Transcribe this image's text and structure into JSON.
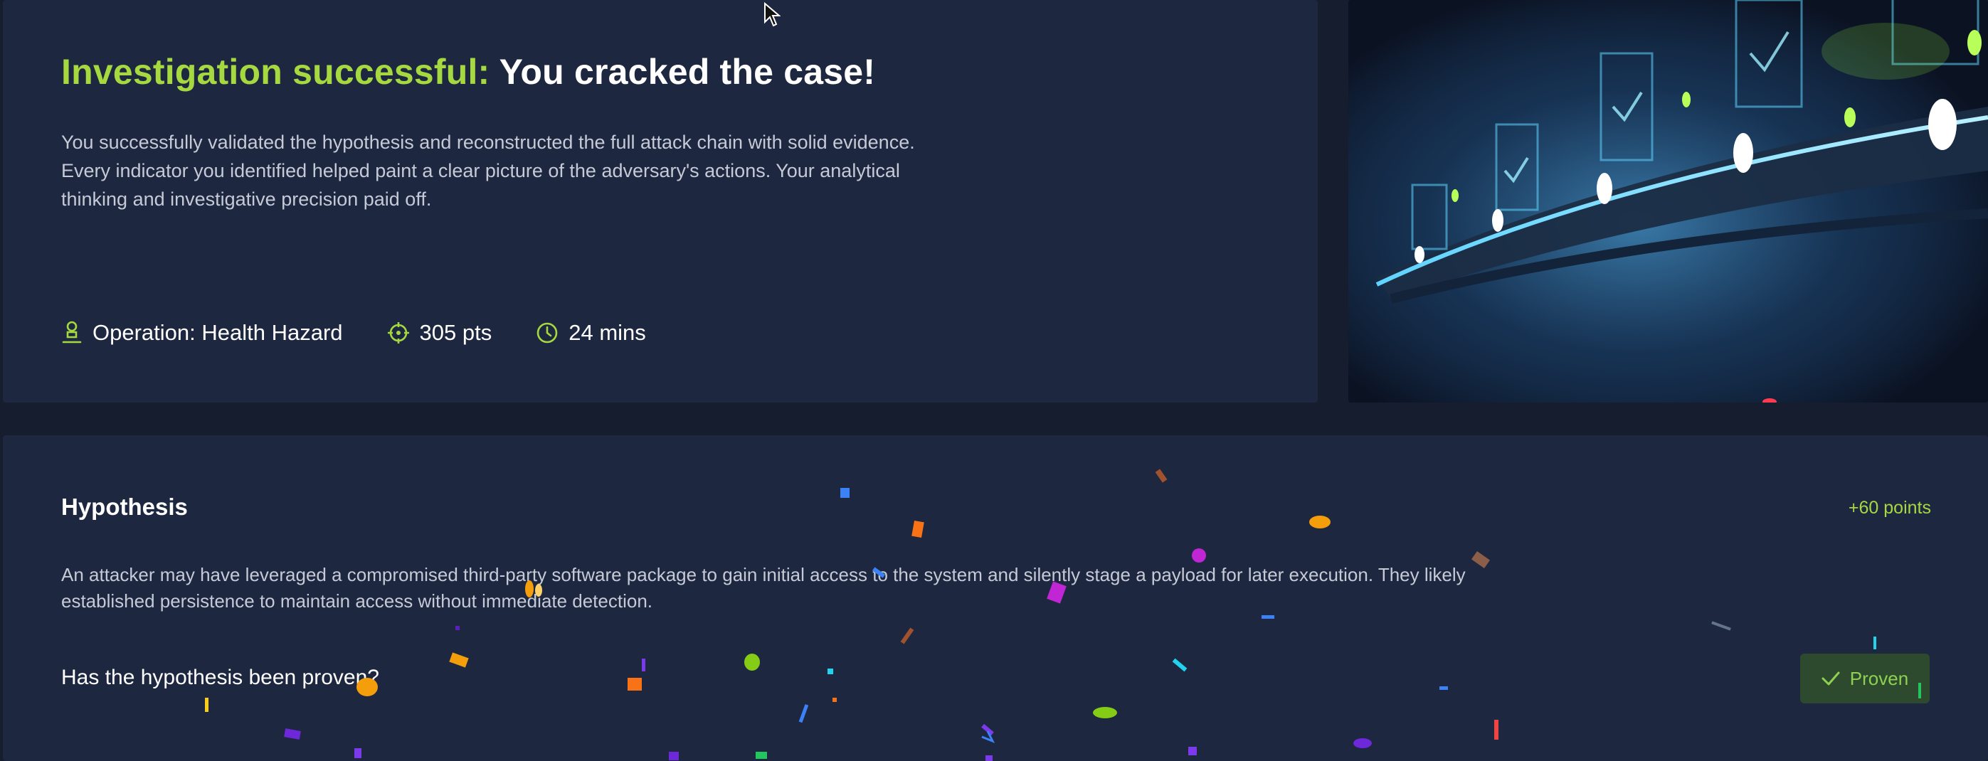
{
  "result": {
    "headline_accent": "Investigation successful:",
    "headline_rest": "You cracked the case!",
    "summary": "You successfully validated the hypothesis and reconstructed the full attack chain with solid evidence. Every indicator you identified helped paint a clear picture of the adversary's actions. Your analytical thinking and investigative precision paid off.",
    "operation": "Operation: Health Hazard",
    "points": "305 pts",
    "duration": "24 mins",
    "icons": {
      "operation": "badge-person-icon",
      "points": "crosshair-icon",
      "duration": "clock-icon"
    }
  },
  "hypothesis": {
    "title": "Hypothesis",
    "points": "+60 points",
    "text": "An attacker may have leveraged a compromised third-party software package to gain initial access to the system and silently stage a payload for later execution. They likely established persistence to maintain access without immediate detection.",
    "question": "Has the hypothesis been proven?",
    "status_label": "Proven",
    "status_icon": "checkmark-icon"
  },
  "colors": {
    "accent": "#a6d83f",
    "panel": "#1e2740",
    "background": "#161d2f",
    "proven_bg": "#2d4a2e",
    "proven_text": "#8ed150"
  }
}
